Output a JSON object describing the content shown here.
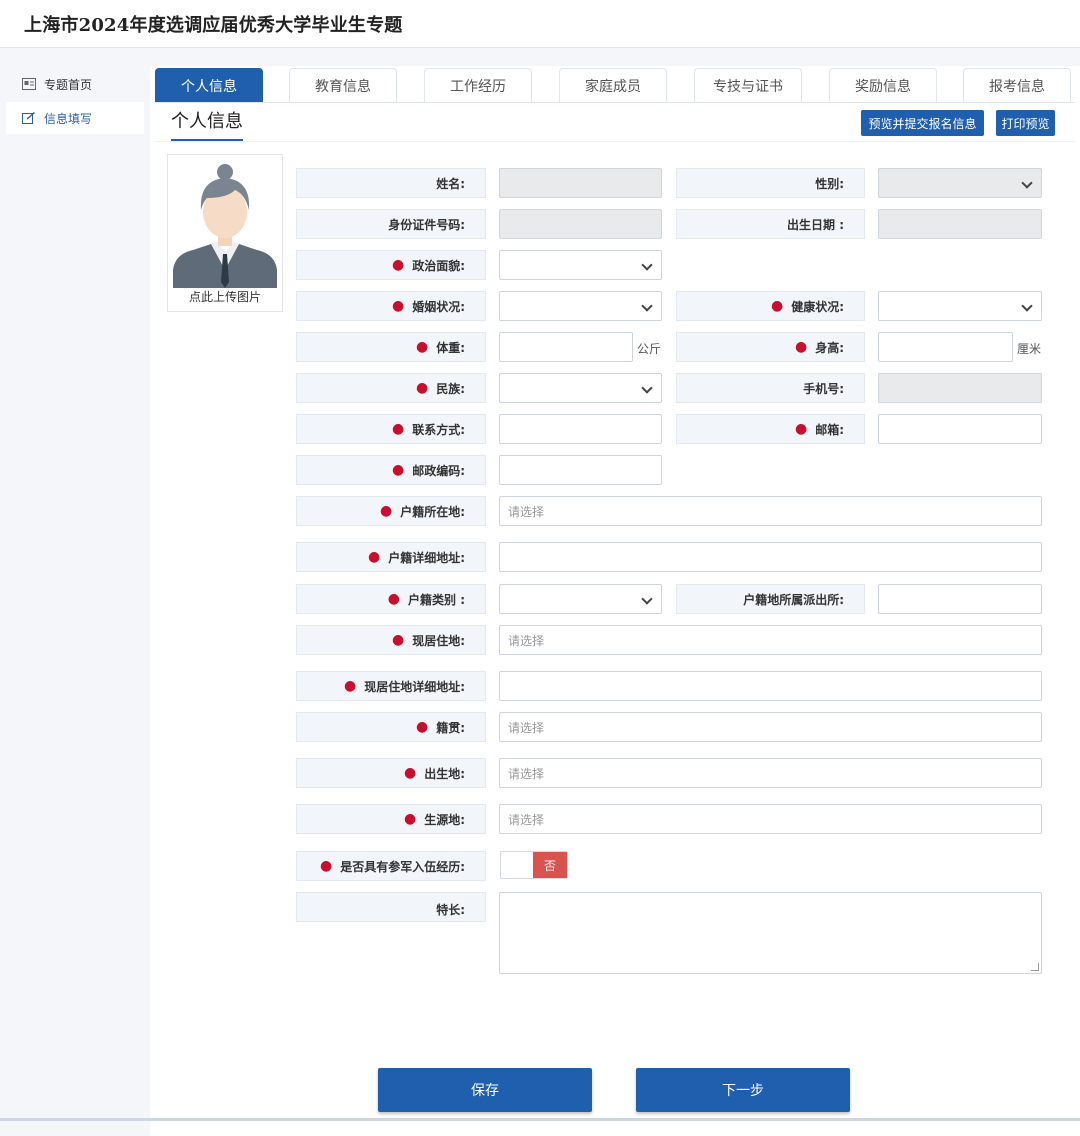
{
  "header": {
    "title": "上海市2024年度选调应届优秀大学毕业生专题"
  },
  "sidebar": {
    "items": [
      {
        "label": "专题首页",
        "icon": "home-card-icon"
      },
      {
        "label": "信息填写",
        "icon": "edit-icon"
      }
    ]
  },
  "tabs": [
    {
      "label": "个人信息"
    },
    {
      "label": "教育信息"
    },
    {
      "label": "工作经历"
    },
    {
      "label": "家庭成员"
    },
    {
      "label": "专技与证书"
    },
    {
      "label": "奖励信息"
    },
    {
      "label": "报考信息"
    }
  ],
  "section": {
    "title": "个人信息",
    "preview_submit_label": "预览并提交报名信息",
    "print_preview_label": "打印预览"
  },
  "photo": {
    "caption": "点此上传图片",
    "icon": "avatar-placeholder-icon"
  },
  "form": {
    "name": {
      "label": "姓名:"
    },
    "gender": {
      "label": "性别:"
    },
    "id_number": {
      "label": "身份证件号码:"
    },
    "birth_date": {
      "label": "出生日期 :"
    },
    "political_status": {
      "label": "政治面貌:"
    },
    "marital_status": {
      "label": "婚姻状况:"
    },
    "health_status": {
      "label": "健康状况:"
    },
    "weight": {
      "label": "体重:",
      "unit": "公斤"
    },
    "height": {
      "label": "身高:",
      "unit": "厘米"
    },
    "ethnicity": {
      "label": "民族:"
    },
    "mobile": {
      "label": "手机号:"
    },
    "contact": {
      "label": "联系方式:"
    },
    "email": {
      "label": "邮箱:"
    },
    "postal_code": {
      "label": "邮政编码:"
    },
    "hukou_location": {
      "label": "户籍所在地:",
      "placeholder": "请选择"
    },
    "hukou_address": {
      "label": "户籍详细地址:"
    },
    "hukou_type": {
      "label": "户籍类别 :"
    },
    "hukou_police_station": {
      "label": "户籍地所属派出所:"
    },
    "residence": {
      "label": "现居住地:",
      "placeholder": "请选择"
    },
    "residence_address": {
      "label": "现居住地详细地址:"
    },
    "native_place": {
      "label": "籍贯:",
      "placeholder": "请选择"
    },
    "birth_place": {
      "label": "出生地:",
      "placeholder": "请选择"
    },
    "student_origin": {
      "label": "生源地:",
      "placeholder": "请选择"
    },
    "military_service": {
      "label": "是否具有参军入伍经历:",
      "value": "否"
    },
    "specialty": {
      "label": "特长:"
    }
  },
  "actions": {
    "save_label": "保存",
    "next_label": "下一步"
  },
  "colors": {
    "primary": "#1f5fae",
    "required": "#c8102e",
    "toggle_off": "#d9534f"
  }
}
